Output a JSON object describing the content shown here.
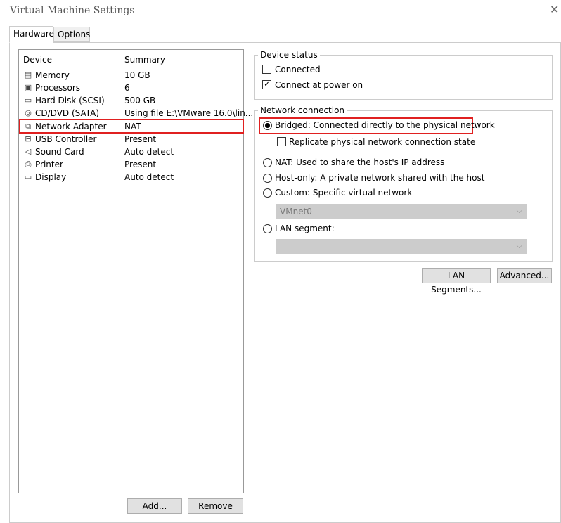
{
  "window": {
    "title": "Virtual Machine Settings"
  },
  "tabs": [
    {
      "label": "Hardware",
      "active": true
    },
    {
      "label": "Options",
      "active": false
    }
  ],
  "device_list": {
    "columns": {
      "device": "Device",
      "summary": "Summary"
    },
    "rows": [
      {
        "name": "Memory",
        "summary": "10 GB",
        "icon": "memory-icon"
      },
      {
        "name": "Processors",
        "summary": "6",
        "icon": "processor-icon"
      },
      {
        "name": "Hard Disk (SCSI)",
        "summary": "500 GB",
        "icon": "hard-disk-icon"
      },
      {
        "name": "CD/DVD (SATA)",
        "summary": "Using file E:\\VMware 16.0\\lin...",
        "icon": "cd-dvd-icon"
      },
      {
        "name": "Network Adapter",
        "summary": "NAT",
        "icon": "network-adapter-icon",
        "selected": true
      },
      {
        "name": "USB Controller",
        "summary": "Present",
        "icon": "usb-icon"
      },
      {
        "name": "Sound Card",
        "summary": "Auto detect",
        "icon": "speaker-icon"
      },
      {
        "name": "Printer",
        "summary": "Present",
        "icon": "printer-icon"
      },
      {
        "name": "Display",
        "summary": "Auto detect",
        "icon": "display-icon"
      }
    ]
  },
  "device_status": {
    "label": "Device status",
    "connected": {
      "label": "Connected",
      "checked": false
    },
    "connect_at_power_on": {
      "label": "Connect at power on",
      "checked": true
    }
  },
  "network_connection": {
    "label": "Network connection",
    "bridged": {
      "label": "Bridged: Connected directly to the physical network",
      "selected": true
    },
    "replicate": {
      "label": "Replicate physical network connection state",
      "checked": false
    },
    "nat": {
      "label": "NAT: Used to share the host's IP address",
      "selected": false
    },
    "host_only": {
      "label": "Host-only: A private network shared with the host",
      "selected": false
    },
    "custom": {
      "label": "Custom: Specific virtual network",
      "selected": false
    },
    "custom_select": {
      "value": "VMnet0"
    },
    "lan_segment": {
      "label": "LAN segment:",
      "selected": false
    },
    "lan_select": {
      "value": ""
    }
  },
  "buttons": {
    "lan_segments": "LAN Segments...",
    "advanced": "Advanced...",
    "add": "Add...",
    "remove": "Remove"
  },
  "colors": {
    "highlight": "#e02020"
  }
}
